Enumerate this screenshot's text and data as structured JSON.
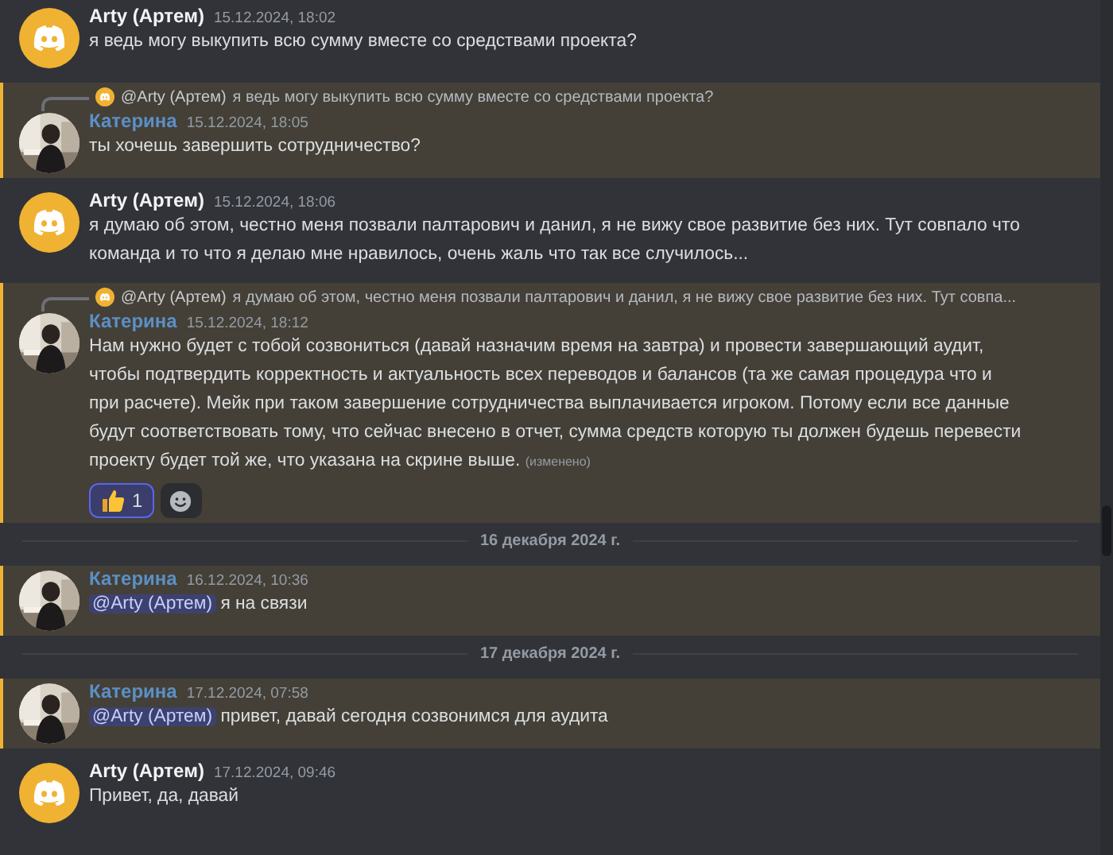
{
  "items": [
    {
      "kind": "message",
      "photo_avatar": false,
      "author": "Arty (Артем)",
      "color": "#f2f3f5",
      "time": "15.12.2024, 18:02",
      "highlighted": false,
      "text": "я ведь могу выкупить всю сумму вместе со средствами проекта?"
    },
    {
      "kind": "message",
      "photo_avatar": true,
      "author": "Катерина",
      "color": "#5c8fc6",
      "time": "15.12.2024, 18:05",
      "highlighted": true,
      "reply": {
        "author": "@Arty (Артем)",
        "text": "я ведь могу выкупить всю сумму вместе со средствами проекта?"
      },
      "text": "ты хочешь завершить сотрудничество?"
    },
    {
      "kind": "message",
      "photo_avatar": false,
      "author": "Arty (Артем)",
      "color": "#f2f3f5",
      "time": "15.12.2024, 18:06",
      "highlighted": false,
      "text": "я думаю об этом, честно меня позвали палтарович и данил, я не вижу свое развитие без них. Тут совпало что команда и то что я делаю мне нравилось, очень жаль что так все случилось..."
    },
    {
      "kind": "message",
      "photo_avatar": true,
      "author": "Катерина",
      "color": "#5c8fc6",
      "time": "15.12.2024, 18:12",
      "highlighted": true,
      "reply": {
        "author": "@Arty (Артем)",
        "text": "я думаю об этом, честно меня позвали палтарович и данил, я не вижу свое развитие без них. Тут совпа..."
      },
      "text": "Нам нужно будет с тобой созвониться (давай назначим время на завтра) и провести завершающий аудит, чтобы подтвердить корректность и актуальность всех переводов и балансов (та же самая процедура что и при расчете). Мейк при таком завершение сотрудничества выплачивается игроком. Потому если все данные будут соответствовать тому, что сейчас внесено в отчет, сумма средств которую ты должен будешь перевести проекту будет той же, что указана на скрине выше.",
      "edited": "(изменено)",
      "reactions": [
        {
          "count": "1",
          "selected": true
        }
      ]
    },
    {
      "kind": "divider",
      "label": "16 декабря 2024 г."
    },
    {
      "kind": "message",
      "photo_avatar": true,
      "author": "Катерина",
      "color": "#5c8fc6",
      "time": "16.12.2024, 10:36",
      "highlighted": true,
      "mention": "@Arty (Артем)",
      "text": "я на связи"
    },
    {
      "kind": "divider",
      "label": "17 декабря 2024 г."
    },
    {
      "kind": "message",
      "photo_avatar": true,
      "author": "Катерина",
      "color": "#5c8fc6",
      "time": "17.12.2024, 07:58",
      "highlighted": true,
      "mention": "@Arty (Артем)",
      "text": "привет, давай сегодня созвонимся для аудита"
    },
    {
      "kind": "message",
      "photo_avatar": false,
      "author": "Arty (Артем)",
      "color": "#f2f3f5",
      "time": "17.12.2024, 09:46",
      "highlighted": false,
      "text": "Привет, да, давай"
    }
  ]
}
